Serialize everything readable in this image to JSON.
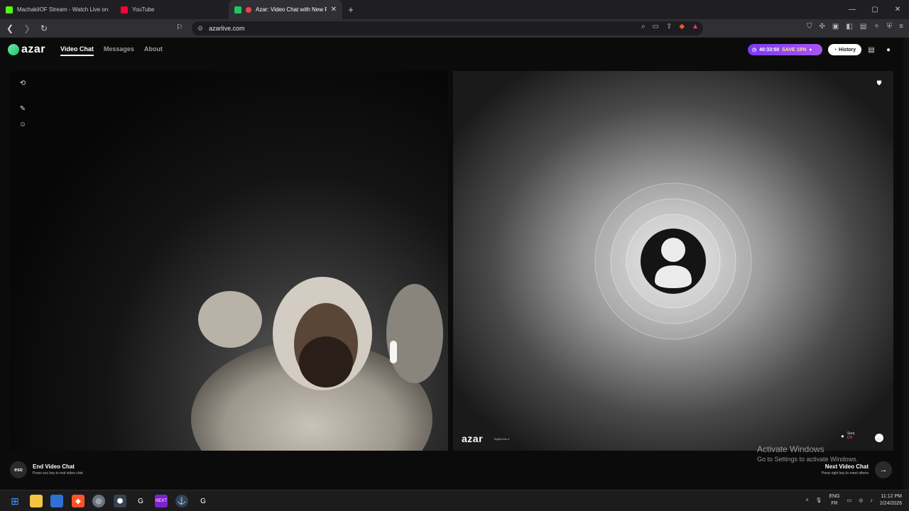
{
  "browser": {
    "tabs": [
      {
        "title": "MachakilOF Stream - Watch Live on K",
        "favicon_color": "#53fc18"
      },
      {
        "title": "YouTube",
        "favicon_color": "#ff0033"
      },
      {
        "title": "Azar: Video Chat with New Pe",
        "favicon_color": "#22c55e",
        "active": true
      }
    ],
    "new_tab": "+",
    "url": "azarlive.com",
    "window_controls": {
      "minimize": "—",
      "maximize": "▢",
      "close": "✕"
    }
  },
  "app": {
    "logo": "azar",
    "nav": [
      {
        "label": "Video Chat",
        "active": true
      },
      {
        "label": "Messages",
        "active": false
      },
      {
        "label": "About",
        "active": false
      }
    ],
    "promo": {
      "timer": "40:33:50",
      "save": "SAVE 15%"
    },
    "history_label": "History",
    "watermark": "azar",
    "watermark_id": "6qB0x33c-b",
    "peer": {
      "name": "Sara",
      "country": "CH"
    },
    "end": {
      "key": "esc",
      "title": "End Video Chat",
      "subtitle": "Press esc key to end video chat"
    },
    "next": {
      "title": "Next Video Chat",
      "subtitle": "Press right key to meet others"
    }
  },
  "os": {
    "activate_title": "Activate Windows",
    "activate_subtitle": "Go to Settings to activate Windows.",
    "lang_top": "ENG",
    "lang_bottom": "FR",
    "time": "11:12 PM",
    "date": "2/24/2026"
  },
  "colors": {
    "accent": "#22c55e",
    "promo": "#7c3aed",
    "brave": "#fb542b"
  }
}
